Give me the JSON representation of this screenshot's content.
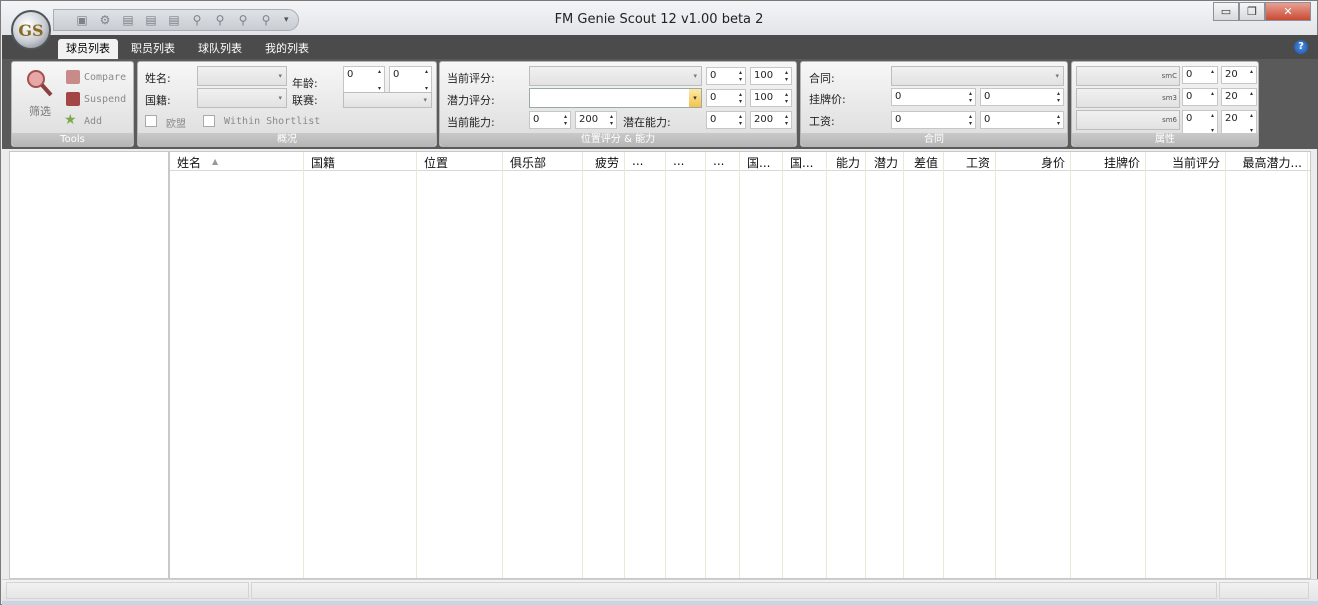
{
  "window": {
    "title": "FM Genie Scout 12 v1.00 beta 2",
    "logo": "GS"
  },
  "qat": {
    "icons": [
      "save-icon",
      "settings-icon",
      "export-icon",
      "import-icon",
      "report-icon",
      "search-player-icon",
      "search-staff-icon",
      "find-icon",
      "filter-icon"
    ],
    "more": "▾"
  },
  "window_buttons": {
    "minimize": "▭",
    "maximize": "❐",
    "close": "✕"
  },
  "tabs": [
    "球员列表",
    "职员列表",
    "球队列表",
    "我的列表"
  ],
  "help": "?",
  "tools": {
    "filter": "筛选",
    "compare": "Compare",
    "suspend": "Suspend",
    "add": "Add",
    "caption": "Tools"
  },
  "overview": {
    "name_label": "姓名:",
    "nation_label": "国籍:",
    "age_label": "年龄:",
    "age_min": "0",
    "age_max": "0",
    "league_label": "联赛:",
    "eu_label": "欧盟",
    "shortlist_label": "Within Shortlist",
    "caption": "概况"
  },
  "position": {
    "current_rating_label": "当前评分:",
    "potential_rating_label": "潜力评分:",
    "current_ability_label": "当前能力:",
    "potential_ability_label": "潜在能力:",
    "cr_min": "0",
    "cr_max": "100",
    "pr_min": "0",
    "pr_max": "100",
    "ca_min": "0",
    "ca_max": "200",
    "pa_min": "0",
    "pa_max": "200",
    "caption": "位置评分 & 能力"
  },
  "contract": {
    "contract_label": "合同:",
    "release_label": "挂牌价:",
    "wage_label": "工资:",
    "release_min": "0",
    "release_max": "0",
    "wage_min": "0",
    "wage_max": "0",
    "caption": "合同"
  },
  "attributes": {
    "fields": [
      "smC",
      "sm3",
      "sm6"
    ],
    "rows": [
      [
        "0",
        "20"
      ],
      [
        "0",
        "20"
      ],
      [
        "0",
        "20"
      ]
    ],
    "caption": "属性"
  },
  "grid": {
    "columns": [
      "姓名",
      "国籍",
      "位置",
      "俱乐部",
      "疲劳",
      "...",
      "...",
      "...",
      "国...",
      "国...",
      "能力",
      "潜力",
      "差值",
      "工资",
      "身价",
      "挂牌价",
      "当前评分",
      "最高潜力..."
    ]
  },
  "sort_indicator": "▲"
}
